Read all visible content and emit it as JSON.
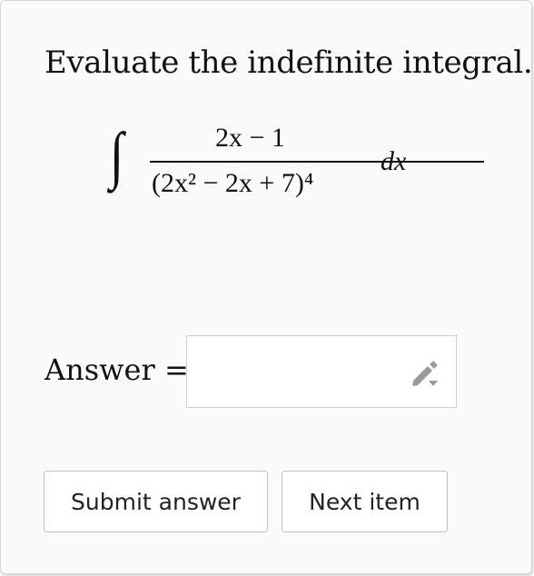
{
  "question": {
    "prompt": "Evaluate the indefinite integral."
  },
  "integral": {
    "numerator": "2x − 1",
    "denominator": "(2x² − 2x + 7)⁴",
    "differential": "dx"
  },
  "answer": {
    "label": "Answer =",
    "value": "",
    "placeholder": ""
  },
  "buttons": {
    "submit_label": "Submit answer",
    "next_label": "Next item"
  },
  "icons": {
    "answer_editor": "pencil-icon"
  },
  "colors": {
    "card_background": "#fafafa",
    "border": "#d6d6d6",
    "icon": "#999999"
  }
}
